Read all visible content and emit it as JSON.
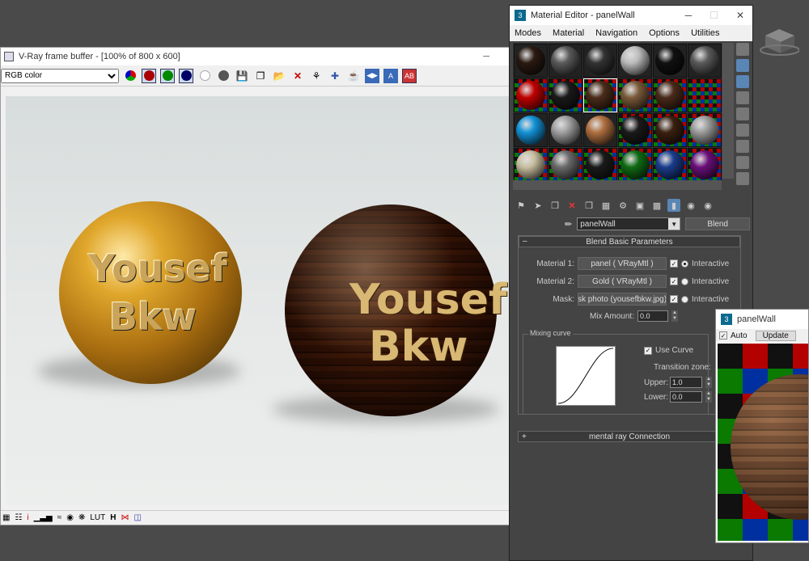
{
  "vfb": {
    "title": "V-Ray frame buffer - [100% of 800 x 600]",
    "channel_select": "RGB color",
    "render_text_line1": "Yousef",
    "render_text_line2": "Bkw"
  },
  "material_editor": {
    "title": "Material Editor - panelWall",
    "menu": [
      "Modes",
      "Material",
      "Navigation",
      "Options",
      "Utilities"
    ],
    "material_name": "panelWall",
    "material_type": "Blend",
    "rollout_title": "Blend Basic Parameters",
    "material1_label": "Material 1:",
    "material1_value": "panel ( VRayMtl )",
    "material2_label": "Material 2:",
    "material2_value": "Gold ( VRayMtl )",
    "mask_label": "Mask:",
    "mask_value": "sk photo (yousefbkw.jpg)",
    "interactive_label": "Interactive",
    "mix_amount_label": "Mix Amount:",
    "mix_amount_value": "0.0",
    "mixing_curve_label": "Mixing curve",
    "use_curve_label": "Use Curve",
    "transition_zone_label": "Transition zone:",
    "upper_label": "Upper:",
    "upper_value": "1.0",
    "lower_label": "Lower:",
    "lower_value": "0.0",
    "rollout2_title": "mental ray Connection",
    "slot_colors": [
      "#2a1a12",
      "#5a5a5a",
      "#333",
      "#bcbcbc",
      "#111",
      "#5a5a5a",
      "#c00000",
      "#1a1a1a",
      "#4a2c1a",
      "#7a5a3a",
      "#4a2a1a",
      "checker",
      "#1493d8",
      "#a0a0a0",
      "#b07040",
      "#1a1a1a",
      "#3a2010",
      "#9a9a9a",
      "#c8bea0",
      "#6a6a6a",
      "#1a1a1a",
      "#0f6a14",
      "#1a3c8c",
      "#6a0f7a"
    ]
  },
  "preview_window": {
    "title": "panelWall",
    "auto_label": "Auto",
    "update_label": "Update"
  }
}
